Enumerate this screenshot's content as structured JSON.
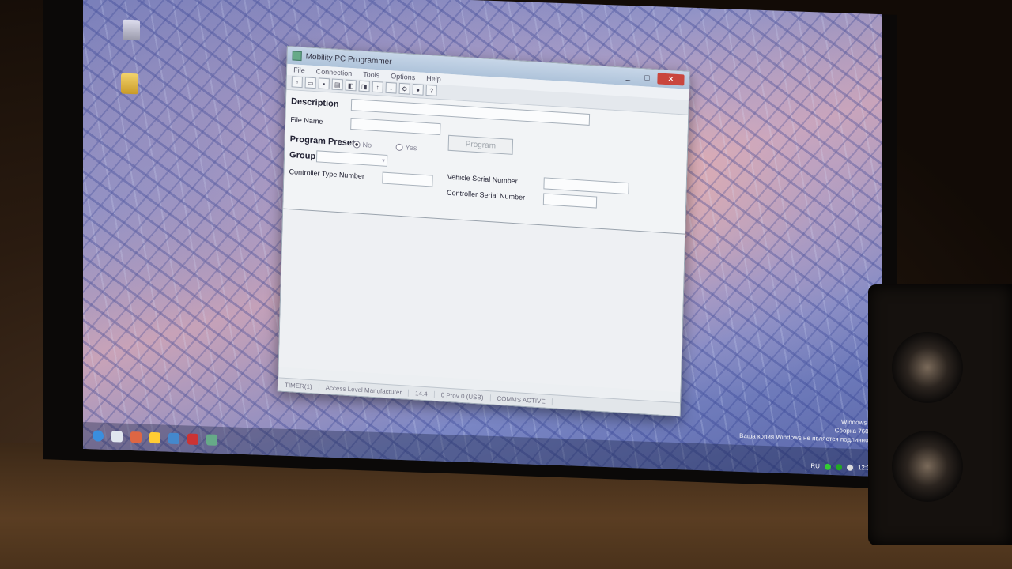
{
  "window": {
    "title": "Mobility PC Programmer",
    "controls": {
      "minimize": "_",
      "maximize": "□",
      "close": "✕"
    }
  },
  "menu": [
    "File",
    "Connection",
    "Tools",
    "Options",
    "Help"
  ],
  "toolbar_icons": [
    "new-icon",
    "open-icon",
    "save-icon",
    "print-icon",
    "read-icon",
    "write-icon",
    "up-icon",
    "down-icon",
    "settings-icon",
    "lock-icon",
    "help-icon"
  ],
  "form": {
    "description_label": "Description",
    "description_value": "",
    "file_name_label": "File Name",
    "file_name_value": "",
    "program_button": "Program",
    "program_presets_label": "Program Presets",
    "preset_no": "No",
    "preset_yes": "Yes",
    "preset_selected": "No",
    "group_label": "Group",
    "group_value": "",
    "controller_type_label": "Controller Type Number",
    "controller_type_value": "",
    "vehicle_serial_label": "Vehicle Serial Number",
    "vehicle_serial_value": "",
    "controller_serial_label": "Controller Serial Number",
    "controller_serial_value": ""
  },
  "status": {
    "s1": "TIMER(1)",
    "s2": "Access Level  Manufacturer",
    "s3": "14.4",
    "s4": "0 Prov 0 (USB)",
    "s5": "COMMS ACTIVE"
  },
  "watermark": {
    "line1": "Windows 7",
    "line2": "Сборка 7601",
    "line3": "Ваша копия Windows не является подлинной"
  },
  "tray": {
    "lang": "RU",
    "clock": "12:30"
  },
  "colors": {
    "close_button": "#c9463d",
    "wallpaper": "#7a86c4"
  }
}
